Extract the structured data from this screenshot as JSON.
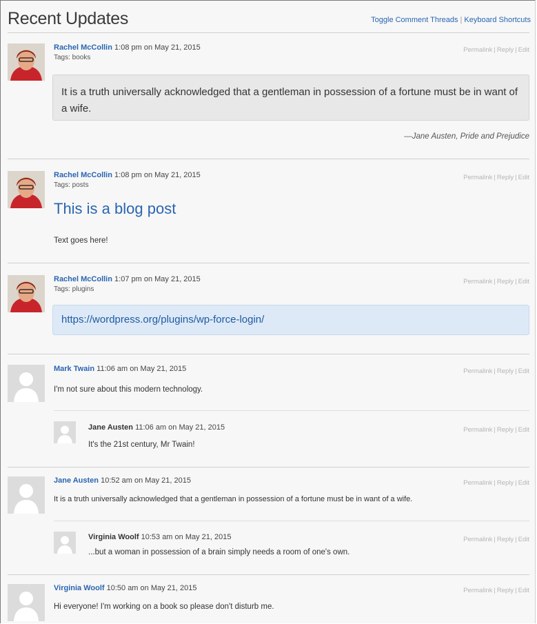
{
  "header": {
    "title": "Recent Updates",
    "links": [
      "Toggle Comment Threads",
      "Keyboard Shortcuts"
    ],
    "separator": "|"
  },
  "actions": {
    "permalink": "Permalink",
    "reply": "Reply",
    "edit": "Edit",
    "separator": "|"
  },
  "posts": [
    {
      "author": "Rachel McCollin",
      "time": "1:08 pm on May 21, 2015",
      "tags": "Tags: books",
      "quote": "It is a truth universally acknowledged that a gentleman in possession of a fortune must be in want of a wife.",
      "cite": "—Jane Austen, Pride and Prejudice"
    },
    {
      "author": "Rachel McCollin",
      "time": "1:08 pm on May 21, 2015",
      "tags": "Tags: posts",
      "title": "This is a blog post",
      "body": "Text goes here!"
    },
    {
      "author": "Rachel McCollin",
      "time": "1:07 pm on May 21, 2015",
      "tags": "Tags: plugins",
      "link": "https://wordpress.org/plugins/wp-force-login/"
    },
    {
      "author": "Mark Twain",
      "time": "11:06 am on May 21, 2015",
      "text": "I'm not sure about this modern technology.",
      "reply": {
        "author": "Jane Austen",
        "time": "11:06 am on May 21, 2015",
        "text": "It's the 21st century, Mr Twain!"
      }
    },
    {
      "author": "Jane Austen",
      "time": "10:52 am on May 21, 2015",
      "text": "It is a truth universally acknowledged that a gentleman in possession of a fortune must be in want of a wife.",
      "reply": {
        "author": "Virginia Woolf",
        "time": "10:53 am on May 21, 2015",
        "text": "...but a woman in possession of a brain simply needs a room of one's own."
      }
    },
    {
      "author": "Virginia Woolf",
      "time": "10:50 am on May 21, 2015",
      "text": "Hi everyone! I'm working on a book so please don't disturb me."
    }
  ],
  "colors": {
    "link": "#2a65b0",
    "quote_bg": "#e8e8e8",
    "link_bg": "#dde9f6",
    "action": "#b5b5b5"
  }
}
